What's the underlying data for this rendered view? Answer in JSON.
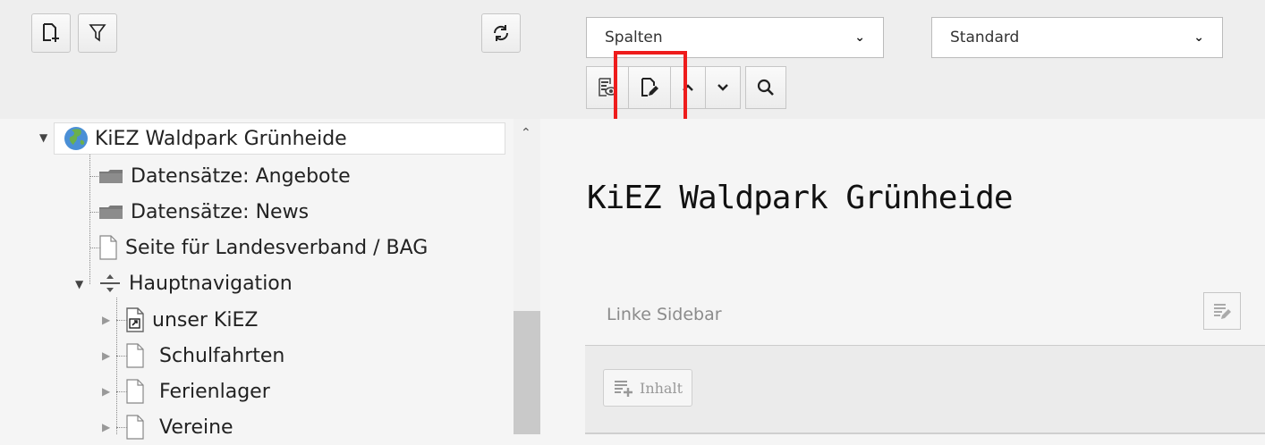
{
  "toolbar": {
    "new_icon": "new-page-icon",
    "filter_icon": "filter-icon",
    "refresh_icon": "refresh-icon",
    "columns_select": {
      "value": "Spalten"
    },
    "language_select": {
      "value": "Standard"
    },
    "doc_buttons": [
      "view-page-icon",
      "edit-page-icon",
      "chevron-up-icon",
      "chevron-down-icon",
      "search-icon"
    ]
  },
  "tree": {
    "root": {
      "label": "KiEZ Waldpark Grünheide",
      "icon": "globe-icon"
    },
    "items": [
      {
        "label": "Datensätze: Angebote",
        "icon": "folder-icon"
      },
      {
        "label": "Datensätze: News",
        "icon": "folder-icon"
      },
      {
        "label": "Seite für Landesverband / BAG",
        "icon": "page-icon"
      },
      {
        "label": "Hauptnavigation",
        "icon": "separator-icon"
      },
      {
        "label": "unser KiEZ",
        "icon": "shortcut-page-icon"
      },
      {
        "label": "Schulfahrten",
        "icon": "page-icon"
      },
      {
        "label": "Ferienlager",
        "icon": "page-icon"
      },
      {
        "label": "Vereine",
        "icon": "page-icon"
      }
    ]
  },
  "main": {
    "page_title": "KiEZ Waldpark Grünheide",
    "column": {
      "title": "Linke Sidebar",
      "add_label": "Inhalt"
    }
  },
  "colors": {
    "highlight": "#ee1c1c",
    "topbar_bg": "#eeeeee",
    "globe_blue": "#4a8fd6",
    "globe_green": "#6ab04c",
    "folder_gray": "#7a7a7a"
  }
}
